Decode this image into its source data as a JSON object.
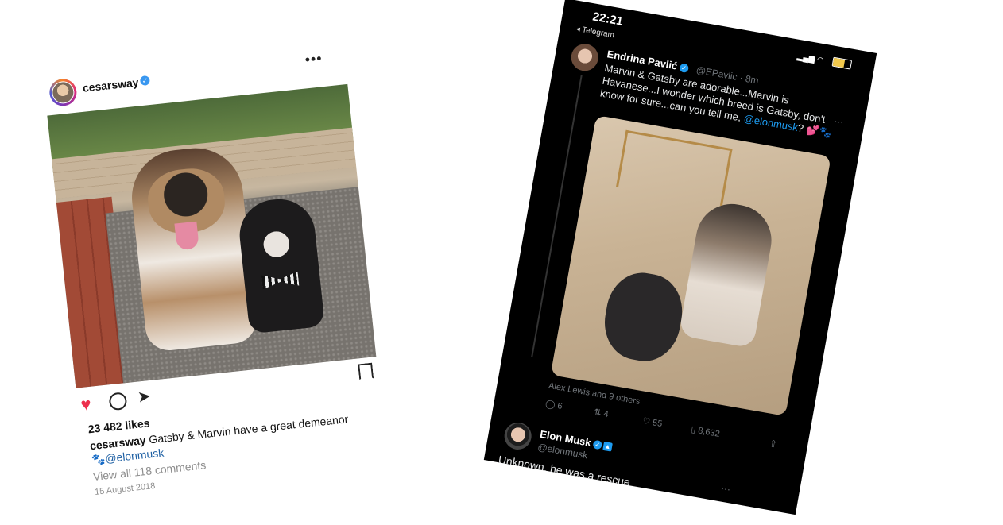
{
  "instagram": {
    "username": "cesarsway",
    "verified_icon": "✓",
    "more_icon": "•••",
    "likes": "23 482 likes",
    "caption_user": "cesarsway",
    "caption_text": "Gatsby & Marvin have a great demeanor",
    "caption_emoji": "🐾",
    "caption_mention": "@elonmusk",
    "view_comments": "View all 118 comments",
    "date": "15 August 2018",
    "heart_color": "#ed2f4c"
  },
  "twitter": {
    "status_time": "22:21",
    "back_label": "◂ Telegram",
    "status_icons": "▂▄▆ ◠",
    "tweet1": {
      "author": "Endrina Pavlić",
      "handle": "@EPavlic · 8m",
      "text": "Marvin & Gatsby are adorable...Marvin is Havanese...I wonder which breed is Gatsby, don't know for sure...can you tell me,",
      "mention": "@elonmusk",
      "text_tail": "? 💕🐾",
      "liked_by": "Alex Lewis and 9 others",
      "replies": "6",
      "retweets": "4",
      "likes": "55",
      "views": "8,632",
      "more_icon": "···"
    },
    "tweet2": {
      "author": "Elon Musk",
      "handle": "@elonmusk",
      "text": "Unknown, he was a rescue",
      "more_icon": "···"
    },
    "accent_color": "#1d9bf0"
  }
}
